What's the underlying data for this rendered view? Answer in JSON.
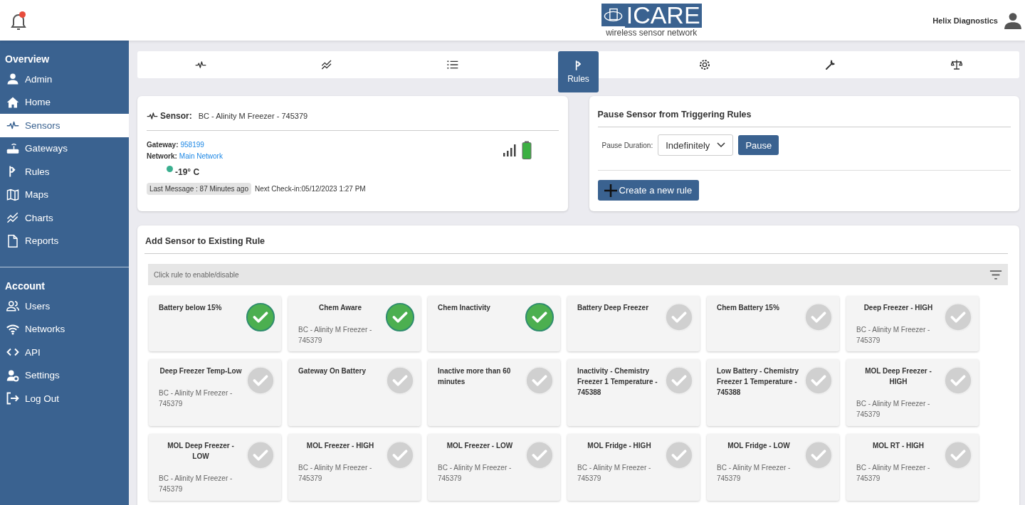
{
  "header": {
    "notifications": {
      "unread": true
    },
    "logo": {
      "name": "ICARE",
      "tagline": "wireless sensor network"
    },
    "account": "Helix Diagnostics"
  },
  "sidebar": {
    "groups": [
      {
        "title": "Overview",
        "items": [
          {
            "label": "Admin",
            "selected": false
          },
          {
            "label": "Home",
            "selected": false
          },
          {
            "label": "Sensors",
            "selected": true
          },
          {
            "label": "Gateways",
            "selected": false
          },
          {
            "label": "Rules",
            "selected": false
          },
          {
            "label": "Maps",
            "selected": false
          },
          {
            "label": "Charts",
            "selected": false
          },
          {
            "label": "Reports",
            "selected": false
          }
        ]
      },
      {
        "title": "Account",
        "items": [
          {
            "label": "Users",
            "selected": false
          },
          {
            "label": "Networks",
            "selected": false
          },
          {
            "label": "API",
            "selected": false
          },
          {
            "label": "Settings",
            "selected": false
          },
          {
            "label": "Log Out",
            "selected": false
          }
        ]
      }
    ]
  },
  "tabs": [
    {
      "selected": false
    },
    {
      "selected": false
    },
    {
      "selected": false
    },
    {
      "label": "Rules",
      "selected": true
    },
    {
      "selected": false
    },
    {
      "selected": false
    },
    {
      "selected": false
    }
  ],
  "sensor": {
    "title_label": "Sensor:",
    "name": "BC - Alinity M Freezer - 745379",
    "gateway_label": "Gateway:",
    "gateway": "958199",
    "network_label": "Network:",
    "network": "Main Network",
    "temperature": "-19° C",
    "last_message": "Last Message : 87 Minutes ago",
    "next_checkin": "Next Check-in:05/12/2023  1:27 PM"
  },
  "pause": {
    "title": "Pause Sensor from Triggering Rules",
    "duration_label": "Pause Duration:",
    "duration": "Indefinitely",
    "pause_button": "Pause",
    "create_button": "Create a new rule"
  },
  "rules": {
    "title": "Add Sensor to Existing Rule",
    "hint": "Click rule to enable/disable",
    "items": [
      {
        "name": "Battery below 15%",
        "enabled": true
      },
      {
        "name": "Chem Aware",
        "sensor": "BC - Alinity M Freezer - 745379",
        "enabled": true
      },
      {
        "name": "Chem Inactivity",
        "enabled": true
      },
      {
        "name": "Battery Deep Freezer",
        "enabled": false
      },
      {
        "name": "Chem Battery 15%",
        "enabled": false
      },
      {
        "name": "Deep Freezer - HIGH",
        "sensor": "BC - Alinity M Freezer - 745379",
        "enabled": false
      },
      {
        "name": "Deep Freezer Temp-Low",
        "sensor": "BC - Alinity M Freezer - 745379",
        "enabled": false
      },
      {
        "name": "Gateway On Battery",
        "enabled": false
      },
      {
        "name": "Inactive more than 60 minutes",
        "enabled": false
      },
      {
        "name": "Inactivity - Chemistry Freezer 1 Temperature - 745388",
        "enabled": false
      },
      {
        "name": "Low Battery - Chemistry Freezer 1 Temperature - 745388",
        "enabled": false
      },
      {
        "name": "MOL Deep Freezer - HIGH",
        "sensor": "BC - Alinity M Freezer - 745379",
        "enabled": false
      },
      {
        "name": "MOL Deep Freezer - LOW",
        "sensor": "BC - Alinity M Freezer - 745379",
        "enabled": false
      },
      {
        "name": "MOL Freezer - HIGH",
        "sensor": "BC - Alinity M Freezer - 745379",
        "enabled": false
      },
      {
        "name": "MOL Freezer - LOW",
        "sensor": "BC - Alinity M Freezer - 745379",
        "enabled": false
      },
      {
        "name": "MOL Fridge - HIGH",
        "sensor": "BC - Alinity M Freezer - 745379",
        "enabled": false
      },
      {
        "name": "MOL Fridge - LOW",
        "sensor": "BC - Alinity M Freezer - 745379",
        "enabled": false
      },
      {
        "name": "MOL RT - HIGH",
        "sensor": "BC - Alinity M Freezer - 745379",
        "enabled": false
      }
    ]
  }
}
